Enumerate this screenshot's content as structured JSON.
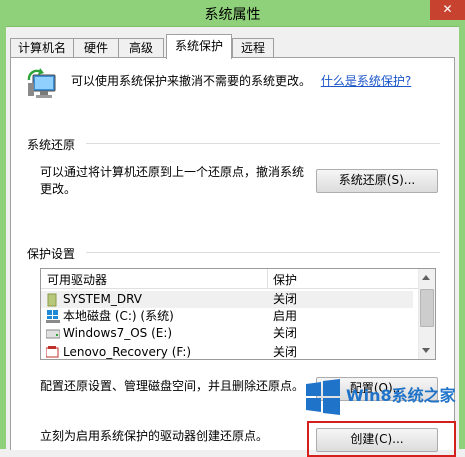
{
  "window": {
    "title": "系统属性",
    "close_glyph": "✕"
  },
  "tabs": [
    {
      "label": "计算机名",
      "active": false
    },
    {
      "label": "硬件",
      "active": false
    },
    {
      "label": "高级",
      "active": false
    },
    {
      "label": "系统保护",
      "active": true
    },
    {
      "label": "远程",
      "active": false
    }
  ],
  "intro": {
    "text": "可以使用系统保护来撤消不需要的系统更改。",
    "link": "什么是系统保护?"
  },
  "restore": {
    "heading": "系统还原",
    "description": "可以通过将计算机还原到上一个还原点，撤消系统更改。",
    "button": "系统还原(S)..."
  },
  "protection": {
    "heading": "保护设置",
    "columns": [
      "可用驱动器",
      "保护"
    ],
    "rows": [
      {
        "drive": "SYSTEM_DRV",
        "status": "关闭",
        "icon": "drive-icon",
        "selected": true
      },
      {
        "drive": "本地磁盘 (C:) (系统)",
        "status": "启用",
        "icon": "windows-drive-icon",
        "selected": false
      },
      {
        "drive": "Windows7_OS (E:)",
        "status": "关闭",
        "icon": "drive-icon",
        "selected": false
      },
      {
        "drive": "Lenovo_Recovery (F:)",
        "status": "关闭",
        "icon": "recovery-drive-icon",
        "selected": false
      }
    ]
  },
  "configure": {
    "text": "配置还原设置、管理磁盘空间，并且删除还原点。",
    "button": "配置(O)..."
  },
  "create": {
    "text": "立刻为启用系统保护的驱动器创建还原点。",
    "button": "创建(C)..."
  },
  "watermark": {
    "text": "Win8系统之家"
  },
  "colors": {
    "titlebar": "#8fd17a",
    "link": "#1c56c8",
    "highlight": "#d4201c"
  }
}
